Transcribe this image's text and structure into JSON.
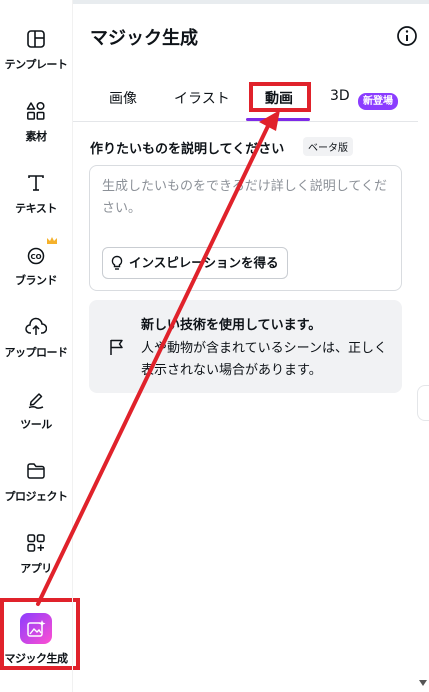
{
  "rail": {
    "items": [
      {
        "label": "テンプレート",
        "icon": "template-icon"
      },
      {
        "label": "素材",
        "icon": "elements-icon"
      },
      {
        "label": "テキスト",
        "icon": "text-icon"
      },
      {
        "label": "ブランド",
        "icon": "brand-icon"
      },
      {
        "label": "アップロード",
        "icon": "upload-icon"
      },
      {
        "label": "ツール",
        "icon": "draw-tool-icon"
      },
      {
        "label": "プロジェクト",
        "icon": "folder-icon"
      },
      {
        "label": "アプリ",
        "icon": "apps-icon"
      },
      {
        "label": "マジック生成",
        "icon": "magic-generate-icon"
      }
    ]
  },
  "panel": {
    "title": "マジック生成",
    "tabs": [
      {
        "label": "画像"
      },
      {
        "label": "イラスト"
      },
      {
        "label": "動画"
      },
      {
        "label": "3D"
      }
    ],
    "new_badge": "新登場",
    "prompt_label": "作りたいものを説明してください",
    "beta_badge": "ベータ版",
    "prompt_placeholder": "生成したいものをできるだけ詳しく説明してください。",
    "inspiration_button": "インスピレーションを得る",
    "notice_title": "新しい技術を使用しています。",
    "notice_body": "人や動物が含まれているシーンは、正しく表示されない場合があります。"
  },
  "colors": {
    "accent": "#7d2ae8",
    "badge": "#8b3dff",
    "annotation": "#e0222b"
  }
}
